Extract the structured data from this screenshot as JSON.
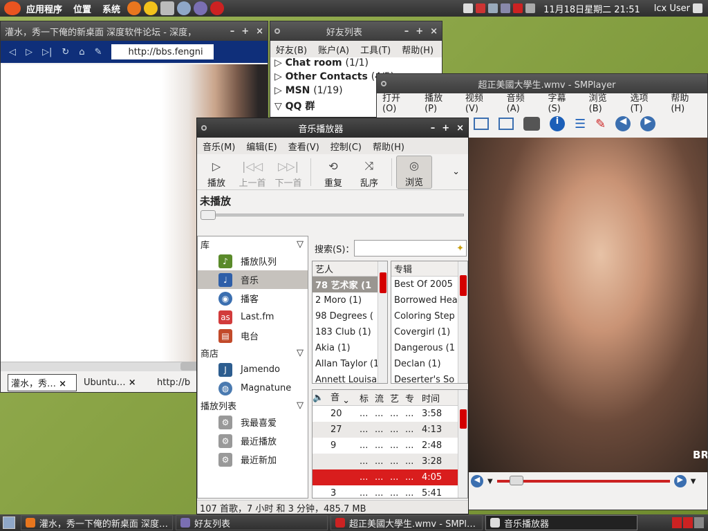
{
  "top_panel": {
    "menus": [
      "应用程序",
      "位置",
      "系统"
    ],
    "clock": "11月18日星期二 21:51",
    "user": "lcx User"
  },
  "browser": {
    "title": "灌水，秀一下俺的新桌面 深度软件论坛 - 深度，",
    "url": "http://bbs.fengni",
    "tabs": [
      "灌水，秀…",
      "Ubuntu…",
      "http://b"
    ]
  },
  "friends": {
    "title": "好友列表",
    "menu": [
      "好友(B)",
      "账户(A)",
      "工具(T)",
      "帮助(H)"
    ],
    "groups": [
      {
        "name": "Chat room",
        "count": "(1/1)"
      },
      {
        "name": "Other Contacts",
        "count": "(4/5)"
      },
      {
        "name": "MSN",
        "count": "(1/19)"
      },
      {
        "name": "QQ 群",
        "count": ""
      }
    ]
  },
  "smplayer": {
    "title": "超正美國大學生.wmv - SMPlayer",
    "menu": [
      "打开(O)",
      "播放(P)",
      "视频(V)",
      "音频(A)",
      "字幕(S)",
      "浏览(B)",
      "选项(T)",
      "帮助(H)"
    ],
    "overlay_text": "BR"
  },
  "music": {
    "title": "音乐播放器",
    "menu": [
      "音乐(M)",
      "编辑(E)",
      "查看(V)",
      "控制(C)",
      "帮助(H)"
    ],
    "toolbar": {
      "play": "播放",
      "prev": "上一首",
      "next": "下一首",
      "repeat": "重复",
      "shuffle": "乱序",
      "browse": "浏览"
    },
    "now_playing": "未播放",
    "library_header": "库",
    "library": [
      {
        "label": "播放队列",
        "icon": "queue-icon",
        "color": "#5a8a2a"
      },
      {
        "label": "音乐",
        "icon": "music-note-icon",
        "color": "#2f5fa8"
      },
      {
        "label": "播客",
        "icon": "podcast-icon",
        "color": "#3b6fb0"
      },
      {
        "label": "Last.fm",
        "icon": "lastfm-icon",
        "color": "#d23b3b"
      },
      {
        "label": "电台",
        "icon": "radio-icon",
        "color": "#c24a2a"
      }
    ],
    "store_header": "商店",
    "store": [
      {
        "label": "Jamendo",
        "icon": "jamendo-icon",
        "color": "#2d5d8f"
      },
      {
        "label": "Magnatune",
        "icon": "magnatune-icon",
        "color": "#4a7ab0"
      }
    ],
    "playlists_header": "播放列表",
    "playlists": [
      {
        "label": "我最喜爱",
        "icon": "gear-icon"
      },
      {
        "label": "最近播放",
        "icon": "gear-icon"
      },
      {
        "label": "最近新加",
        "icon": "gear-icon"
      }
    ],
    "search_label": "搜索(S)：",
    "search_value": "",
    "artist_header": "艺人",
    "artists": [
      "78 艺术家 (1",
      "2 Moro (1)",
      "98 Degrees (",
      "183 Club (1)",
      "Akia (1)",
      "Allan Taylor (1",
      "Annett Louisa"
    ],
    "album_header": "专辑",
    "albums": [
      "Best Of 2005",
      "Borrowed Hea",
      "Coloring Step",
      "Covergirl (1)",
      "Dangerous (1",
      "Declan (1)",
      "Deserter's So"
    ],
    "track_cols": [
      "音",
      "标",
      "流",
      "艺",
      "专",
      "时间"
    ],
    "tracks": [
      {
        "num": "20",
        "t": "...",
        "g": "...",
        "a": "...",
        "al": "...",
        "time": "3:58"
      },
      {
        "num": "27",
        "t": "...",
        "g": "...",
        "a": "...",
        "al": "...",
        "time": "4:13"
      },
      {
        "num": "9",
        "t": "...",
        "g": "...",
        "a": "...",
        "al": "...",
        "time": "2:48"
      },
      {
        "num": "",
        "t": "...",
        "g": "...",
        "a": "...",
        "al": "...",
        "time": "3:28"
      },
      {
        "num": "",
        "t": "...",
        "g": "...",
        "a": "...",
        "al": "...",
        "time": "4:05"
      },
      {
        "num": "3",
        "t": "...",
        "g": "...",
        "a": "...",
        "al": "...",
        "time": "5:41"
      }
    ],
    "status": "107 首歌，7 小时 和 3 分钟，485.7 MB"
  },
  "taskbar": [
    {
      "label": "灌水，秀一下俺的新桌面 深度…",
      "icon": "firefox-icon"
    },
    {
      "label": "好友列表",
      "icon": "pidgin-icon"
    },
    {
      "label": "超正美國大學生.wmv - SMPl…",
      "icon": "smplayer-icon"
    },
    {
      "label": "音乐播放器",
      "icon": "rhythmbox-icon"
    }
  ]
}
